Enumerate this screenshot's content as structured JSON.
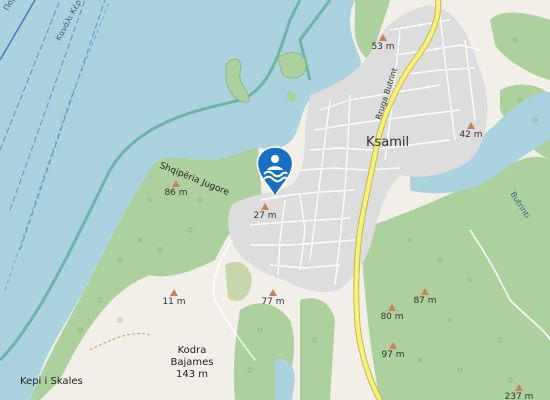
{
  "map": {
    "colors": {
      "water": "#aad3df",
      "land": "#f2efe9",
      "forest": "#add19e",
      "scrub": "#c8d7ab",
      "built": "#dddddd",
      "road": "#f5f080",
      "road_border": "#c9b84a",
      "marker": "#1a6fc3",
      "peak": "#c7845a"
    },
    "labels": {
      "town_ksamil": "Ksamil",
      "road_rruga_butrint": "Rruga Butrint",
      "place_shqiperia_jugore": "Shqipëria Jugore",
      "place_butrinti": "Butrinti",
      "place_kepi_skales": "Kepi i Skales",
      "place_kodra_bajames_line1": "Kodra",
      "place_kodra_bajames_line2": "Bajames",
      "place_kodra_bajames_elev": "143 m",
      "sea_top1": "Πορθμ",
      "sea_top2": "Κανάλι Κέρ"
    },
    "peaks": [
      {
        "elevation": "53 m"
      },
      {
        "elevation": "42 m"
      },
      {
        "elevation": "86 m"
      },
      {
        "elevation": "27 m"
      },
      {
        "elevation": "11 m"
      },
      {
        "elevation": "77 m"
      },
      {
        "elevation": "87 m"
      },
      {
        "elevation": "80 m"
      },
      {
        "elevation": "97 m"
      },
      {
        "elevation": "237 m"
      }
    ],
    "marker": {
      "icon": "swimming-icon"
    }
  }
}
